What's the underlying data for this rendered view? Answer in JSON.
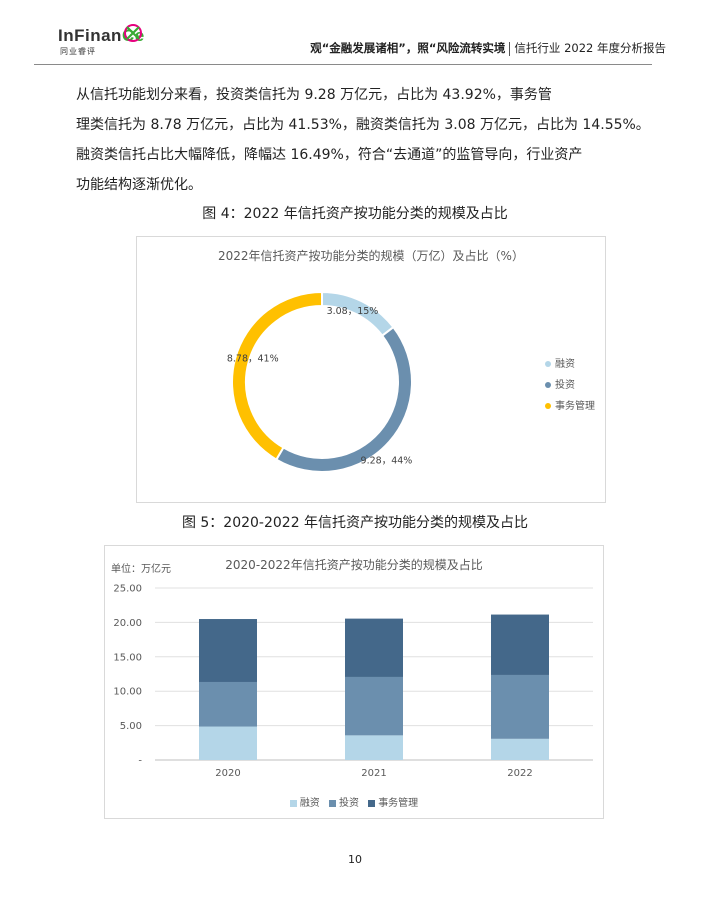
{
  "header": {
    "logo_part1": "InFinan",
    "logo_part2": "Ce",
    "logo_sub": "同业睿评",
    "title_bold": "观“金融发展诸相”，照“风险流转实境",
    "title_plain": "信托行业 2022 年度分析报告"
  },
  "body": {
    "lines": [
      "从信托功能划分来看，投资类信托为 9.28 万亿元，占比为 43.92%，事务管",
      "理类信托为 8.78 万亿元，占比为 41.53%，融资类信托为 3.08 万亿元，占比为 14.55%。",
      "融资类信托占比大幅降低，降幅达 16.49%，符合“去通道”的监管导向，行业资产",
      "功能结构逐渐优化。"
    ]
  },
  "figure4": {
    "caption": "图 4：2022 年信托资产按功能分类的规模及占比"
  },
  "figure5": {
    "caption": "图 5：2020-2022 年信托资产按功能分类的规模及占比"
  },
  "page_number": "10",
  "chart_data": [
    {
      "type": "pie",
      "title": "2022年信托资产按功能分类的规模（万亿）及占比（%）",
      "categories": [
        "融资",
        "投资",
        "事务管理"
      ],
      "values": [
        3.08,
        9.28,
        8.78
      ],
      "percents": [
        15,
        44,
        41
      ],
      "data_labels": [
        "3.08，15%",
        "9.28，44%",
        "8.78，41%"
      ],
      "colors": [
        "#b4d6e8",
        "#6b8fae",
        "#ffc000"
      ],
      "legend": "right"
    },
    {
      "type": "bar",
      "stacked": true,
      "title": "2020-2022年信托资产按功能分类的规模及占比",
      "unit_label": "单位：万亿元",
      "categories": [
        "2020",
        "2021",
        "2022"
      ],
      "series": [
        {
          "name": "融资",
          "values": [
            4.86,
            3.58,
            3.08
          ],
          "color": "#b4d6e8"
        },
        {
          "name": "投资",
          "values": [
            6.48,
            8.49,
            9.28
          ],
          "color": "#6b8fae"
        },
        {
          "name": "事务管理",
          "values": [
            9.15,
            8.48,
            8.78
          ],
          "color": "#44688a"
        }
      ],
      "y_ticks": [
        "25.00",
        "20.00",
        "15.00",
        "10.00",
        "5.00",
        "-"
      ],
      "ylim": [
        0,
        25
      ],
      "grid": true,
      "legend": "bottom"
    }
  ]
}
